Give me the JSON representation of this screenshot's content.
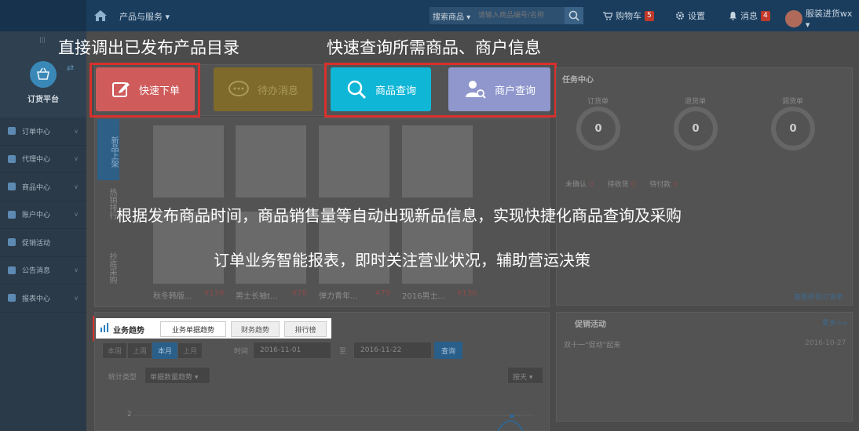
{
  "topbar": {
    "menu_label": "产品与服务 ▾",
    "search_type": "搜索商品 ▾",
    "search_placeholder": "请输入商品编号/名称",
    "cart_label": "购物车",
    "cart_count": "5",
    "settings_label": "设置",
    "messages_label": "消息",
    "messages_count": "4",
    "user_label": "服装进货wx ▾"
  },
  "sidebar": {
    "platform_label": "订货平台",
    "items": [
      {
        "label": "订单中心"
      },
      {
        "label": "代理中心"
      },
      {
        "label": "商品中心"
      },
      {
        "label": "账户中心"
      },
      {
        "label": "促销活动"
      },
      {
        "label": "公告消息"
      },
      {
        "label": "报表中心"
      }
    ]
  },
  "quick_buttons": {
    "order": "快速下单",
    "todo": "待办消息",
    "product_query": "商品查询",
    "merchant_query": "商户查询"
  },
  "side_tabs": {
    "new": "新品上架",
    "hot": "热销排行",
    "deal": "抄底采购"
  },
  "products": [
    {
      "name": "秋冬韩版...",
      "price": "¥139"
    },
    {
      "name": "男士长袖t...",
      "price": "¥70"
    },
    {
      "name": "弹力青年...",
      "price": "¥79"
    },
    {
      "name": "2016男士...",
      "price": "¥130"
    }
  ],
  "tasks": {
    "title": "任务中心",
    "gauges": [
      {
        "label": "订货单",
        "value": "0"
      },
      {
        "label": "退货单",
        "value": "0"
      },
      {
        "label": "调货单",
        "value": "0"
      }
    ],
    "tabs": [
      {
        "label": "未确认",
        "count": "0"
      },
      {
        "label": "待收货",
        "count": "0"
      },
      {
        "label": "待付款",
        "count": "0"
      }
    ],
    "view_all": "查看所有订货单"
  },
  "promotions": {
    "title": "促销活动",
    "more": "更多>>",
    "item": "双十一“促动”起来",
    "date": "2016-10-27"
  },
  "business": {
    "title": "业务趋势",
    "tabs": [
      "业务单据趋势",
      "财务趋势",
      "排行榜"
    ],
    "period_buttons": [
      "本周",
      "上周",
      "本月",
      "上月"
    ],
    "time_label": "时间",
    "date_from": "2016-11-01",
    "to_label": "至",
    "date_to": "2016-11-22",
    "query": "查询",
    "stat_type_label": "统计类型",
    "stat_type_value": "单据数量趋势 ▾",
    "granularity": "按天 ▾",
    "y_tick": "2"
  },
  "overlay": {
    "caption_left": "直接调出已发布产品目录",
    "caption_right": "快速查询所需商品、商户信息",
    "line1": "根据发布商品时间，商品销售量等自动出现新品信息，实现快捷化商品查询及采购",
    "line2": "订单业务智能报表，即时关注营业状况，辅助营运决策"
  },
  "colors": {
    "order_btn": "#cf5b5b",
    "todo_btn": "#7e6a2a",
    "product_btn": "#0fb6d6",
    "merchant_btn": "#8f97cc",
    "highlight": "#d9302c"
  }
}
